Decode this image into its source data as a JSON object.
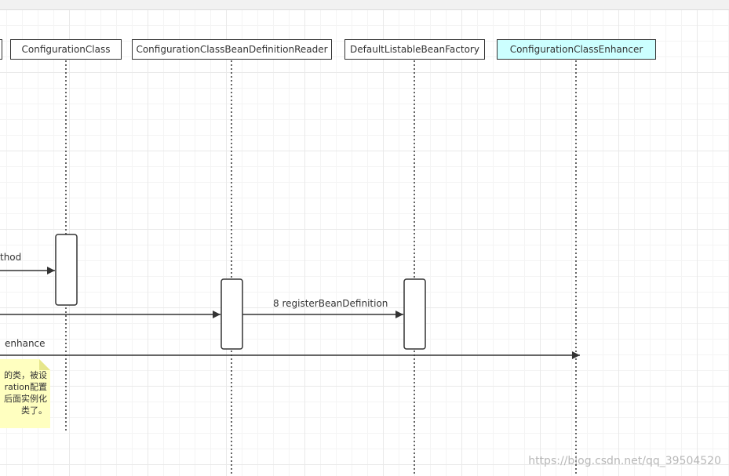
{
  "lifelines": [
    {
      "name": "",
      "label": ""
    },
    {
      "name": "configuration-class",
      "label": "ConfigurationClass"
    },
    {
      "name": "reader",
      "label": "ConfigurationClassBeanDefinitionReader"
    },
    {
      "name": "factory",
      "label": "DefaultListableBeanFactory"
    },
    {
      "name": "enhancer",
      "label": "ConfigurationClassEnhancer"
    }
  ],
  "messages": {
    "m1_label": "thod",
    "m3_label": "8 registerBeanDefinition",
    "m4_label": "enhance"
  },
  "note": {
    "lines": [
      "的类，被设",
      "ration配置",
      "后面实例化",
      "类了。"
    ]
  },
  "watermark": "https://blog.csdn.net/qq_39504520",
  "colors": {
    "highlight": "#ccffff",
    "note": "#ffffc0",
    "stroke": "#333333"
  }
}
